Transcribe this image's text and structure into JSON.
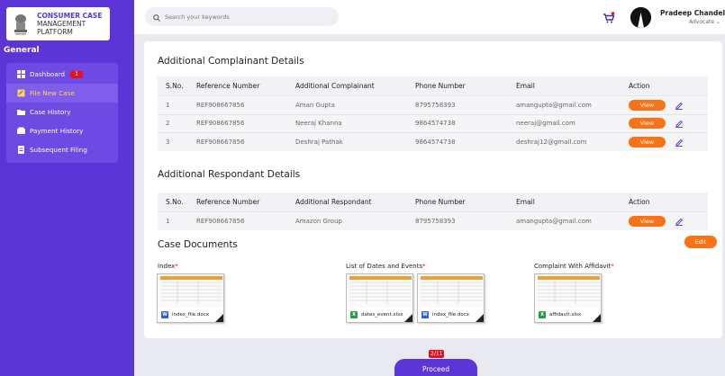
{
  "brand": {
    "line1": "CONSUMER CASE",
    "line2": "MANAGEMENT",
    "line3": "PLATFORM"
  },
  "sidebar": {
    "section": "General",
    "items": [
      {
        "label": "Dashboard",
        "badge": "1",
        "icon": "grid-icon"
      },
      {
        "label": "File New Case",
        "icon": "file-icon"
      },
      {
        "label": "Case History",
        "icon": "folder-icon"
      },
      {
        "label": "Payment History",
        "icon": "wallet-icon"
      },
      {
        "label": "Subsequent Filing",
        "icon": "document-icon"
      }
    ]
  },
  "search": {
    "placeholder": "Search your keywords"
  },
  "user": {
    "name": "Pradeep Chandel",
    "role": "Advocate"
  },
  "complainants": {
    "title": "Additional Complainant Details",
    "headers": [
      "S.No.",
      "Reference Number",
      "Additional Complainant",
      "Phone Number",
      "Email",
      "Action"
    ],
    "rows": [
      {
        "sno": "1",
        "ref": "REF908667856",
        "name": "Aman Gupta",
        "phone": "8795758393",
        "email": "amangupta@gmail.com"
      },
      {
        "sno": "2",
        "ref": "REF908667856",
        "name": "Neeraj Khanna",
        "phone": "9864574738",
        "email": "neeraj@gmail.com"
      },
      {
        "sno": "3",
        "ref": "REF908667856",
        "name": "Deshraj Pathak",
        "phone": "9864574738",
        "email": "deshraj12@gmail.com"
      }
    ]
  },
  "respondants": {
    "title": "Additional Respondant Details",
    "headers": [
      "S.No.",
      "Reference Number",
      "Additional Respondant",
      "Phone Number",
      "Email",
      "Action"
    ],
    "rows": [
      {
        "sno": "1",
        "ref": "REF908667856",
        "name": "Amazon Group",
        "phone": "8795758393",
        "email": "amangupta@gmail.com"
      }
    ]
  },
  "actions": {
    "view": "View",
    "edit": "Edit",
    "proceed": "Proceed",
    "proceed_badge": "2/11"
  },
  "documents": {
    "title": "Case Documents",
    "groups": [
      {
        "label": "Index",
        "files": [
          {
            "name": "index_file.docx",
            "type": "W"
          }
        ]
      },
      {
        "label": "List of Dates and Events",
        "files": [
          {
            "name": "dates_event.xlsx",
            "type": "X"
          },
          {
            "name": "index_file.docx",
            "type": "W"
          }
        ]
      },
      {
        "label": "Complaint With Affidavit",
        "files": [
          {
            "name": "affidavit.xlsx",
            "type": "X"
          }
        ]
      }
    ]
  },
  "colors": {
    "primary": "#5b35d6",
    "accent": "#f97316",
    "badge": "#e8101a",
    "active_text": "#ffd84a"
  }
}
